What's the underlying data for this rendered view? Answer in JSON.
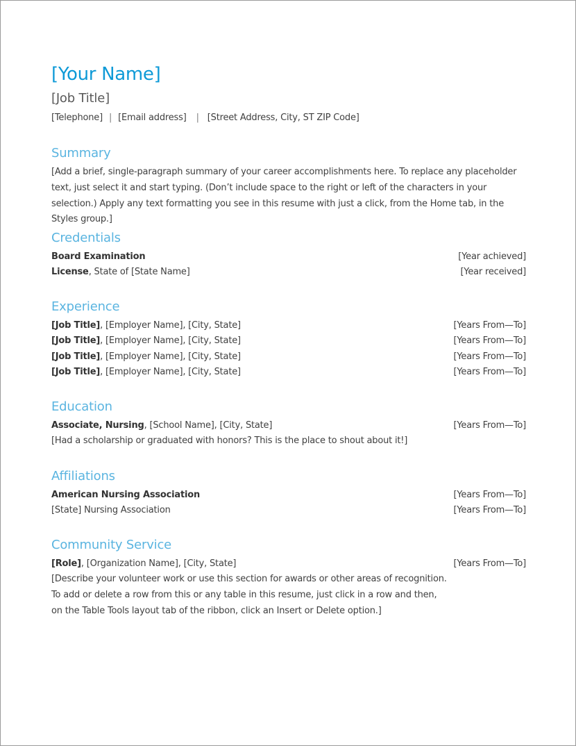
{
  "header": {
    "name": "[Your Name]",
    "job_title": "[Job Title]",
    "contact": {
      "telephone": "[Telephone]",
      "email": "[Email address]",
      "address": "[Street Address, City, ST ZIP Code]",
      "separator": "|"
    }
  },
  "colors": {
    "name": "#0e9ad7",
    "section_heading": "#5ab4e0",
    "body_text": "#404040"
  },
  "summary": {
    "title": "Summary",
    "text": "[Add a brief, single-paragraph summary of your career accomplishments here. To replace any placeholder text, just select it and start typing. (Don’t include space to the right or left of the characters in your selection.) Apply any text formatting you see in this resume with just a click, from the Home tab, in the Styles group.]"
  },
  "credentials": {
    "title": "Credentials",
    "rows": [
      {
        "bold": "Board Examination",
        "rest": "",
        "date": "[Year achieved]"
      },
      {
        "bold": "License",
        "rest": ", State of [State Name]",
        "date": "[Year received]"
      }
    ]
  },
  "experience": {
    "title": "Experience",
    "rows": [
      {
        "bold": "[Job Title]",
        "rest": ", [Employer Name], [City, State]",
        "date": "[Years From—To]"
      },
      {
        "bold": "[Job Title]",
        "rest": ", [Employer Name], [City, State]",
        "date": "[Years From—To]"
      },
      {
        "bold": "[Job Title]",
        "rest": ", [Employer Name], [City, State]",
        "date": "[Years From—To]"
      },
      {
        "bold": "[Job Title]",
        "rest": ", [Employer Name], [City, State]",
        "date": "[Years From—To]"
      }
    ]
  },
  "education": {
    "title": "Education",
    "rows": [
      {
        "bold": "Associate, Nursing",
        "rest": ", [School Name], [City, State]",
        "date": "[Years From—To]"
      }
    ],
    "note": "[Had a scholarship or graduated with honors? This is the place to shout about it!]"
  },
  "affiliations": {
    "title": "Affiliations",
    "rows": [
      {
        "bold": "American Nursing Association",
        "rest": "",
        "date": "[Years From—To]"
      },
      {
        "bold": "",
        "rest": "[State] Nursing Association",
        "date": "[Years From—To]"
      }
    ]
  },
  "community": {
    "title": "Community Service",
    "rows": [
      {
        "bold": "[Role]",
        "rest": ", [Organization Name], [City, State]",
        "date": "[Years From—To]"
      }
    ],
    "note_lines": [
      "[Describe your volunteer work or use this section for awards or other areas of recognition.",
      "To add or delete a row from this or any table in this resume, just click in a row and then,",
      "on the Table Tools layout tab of the ribbon, click an Insert or Delete option.]"
    ]
  }
}
